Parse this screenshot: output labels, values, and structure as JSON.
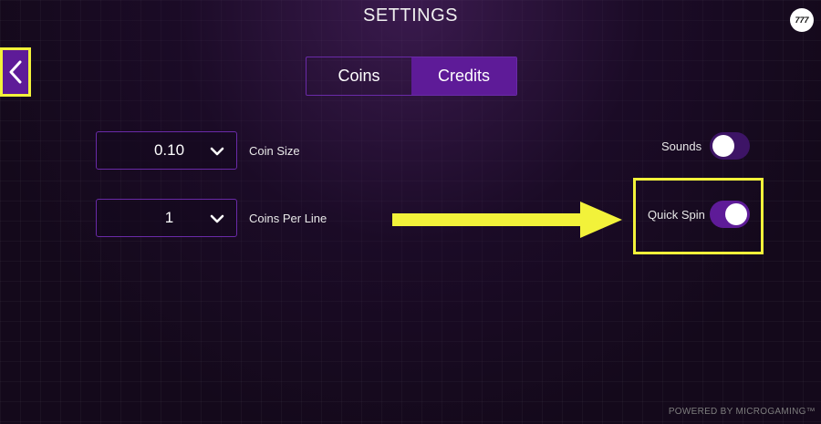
{
  "header": {
    "title": "SETTINGS",
    "logo_text": "777"
  },
  "back_button": {
    "icon": "chevron-left-icon"
  },
  "tabs": [
    {
      "label": "Coins",
      "active": false
    },
    {
      "label": "Credits",
      "active": true
    }
  ],
  "settings": {
    "coin_size": {
      "value": "0.10",
      "label": "Coin Size"
    },
    "coins_per_line": {
      "value": "1",
      "label": "Coins Per Line"
    },
    "sounds": {
      "label": "Sounds",
      "on": false
    },
    "quick_spin": {
      "label": "Quick Spin",
      "on": true
    }
  },
  "footer": {
    "text": "POWERED BY MICROGAMING™"
  },
  "colors": {
    "accent": "#5e1b98",
    "highlight": "#f2f23a",
    "background": "#14091b"
  }
}
